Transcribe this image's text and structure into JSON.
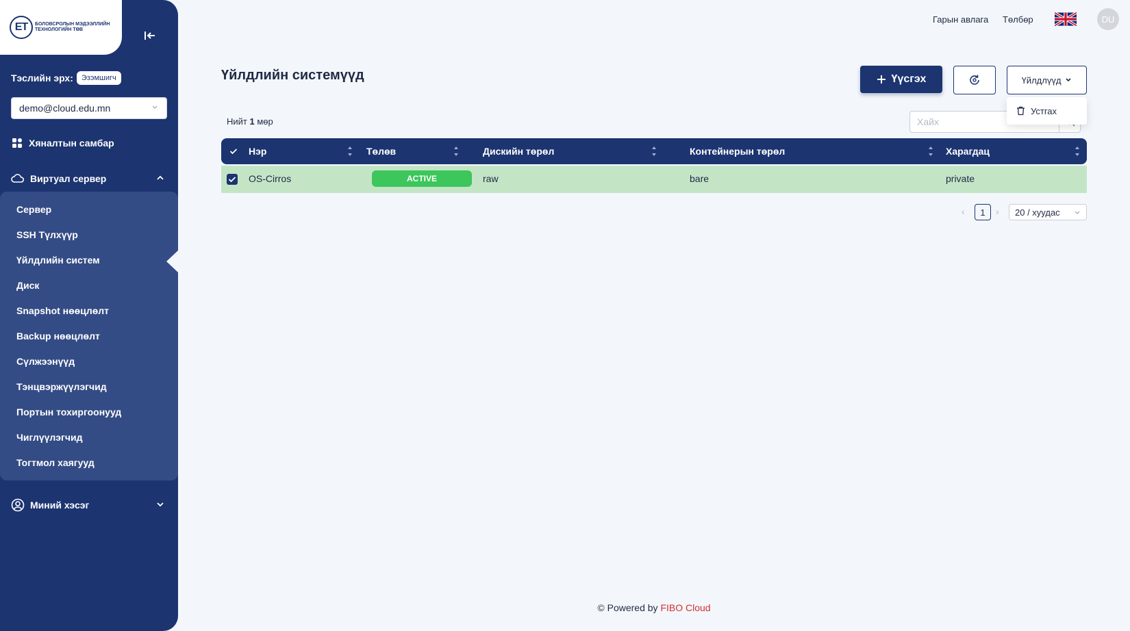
{
  "logo": {
    "mark": "ЕТ",
    "text": "Боловсролын мэдээллийн технологийн төв"
  },
  "sidebar": {
    "role_label": "Тэслийн эрх:",
    "role_badge": "Эзэмшигч",
    "account": "demo@cloud.edu.mn",
    "dashboard": "Хяналтын самбар",
    "virtual_server": "Виртуал сервер",
    "sub_items": [
      "Сервер",
      "SSH Түлхүүр",
      "Үйлдлийн систем",
      "Диск",
      "Snapshot нөөцлөлт",
      "Backup нөөцлөлт",
      "Сүлжээнүүд",
      "Тэнцвэржүүлэгчид",
      "Портын тохиргоонууд",
      "Чиглүүлэгчид",
      "Тогтмол хаягууд"
    ],
    "my_section": "Миний хэсэг"
  },
  "topbar": {
    "guide": "Гарын авлага",
    "payment": "Төлбөр",
    "avatar": "DU",
    "language_icon": "uk-flag-icon"
  },
  "main": {
    "title": "Үйлдлийн системүүд",
    "add_label": "Үүсгэх",
    "actions_label": "Үйлдлүүд",
    "dropdown_delete": "Устгах",
    "search_placeholder": "Хайх",
    "total_prefix": "Нийт",
    "total_count": "1",
    "total_suffix": "мөр"
  },
  "table": {
    "columns": [
      "Нэр",
      "Төлөв",
      "Дискийн төрөл",
      "Контейнерын төрөл",
      "Харагдац"
    ],
    "rows": [
      {
        "name": "OS-Cirros",
        "status": "ACTIVE",
        "disk_type": "raw",
        "container_type": "bare",
        "visibility": "private",
        "selected": true
      }
    ]
  },
  "pagination": {
    "current": "1",
    "page_size": "20 / хуудас"
  },
  "footer": {
    "prefix": "© Powered by",
    "brand": "FIBO Cloud"
  },
  "colors": {
    "primary": "#1c3470",
    "active_status": "#3cc65c",
    "row_highlight": "#c3e5c6",
    "brand_red": "#d32f2f"
  }
}
